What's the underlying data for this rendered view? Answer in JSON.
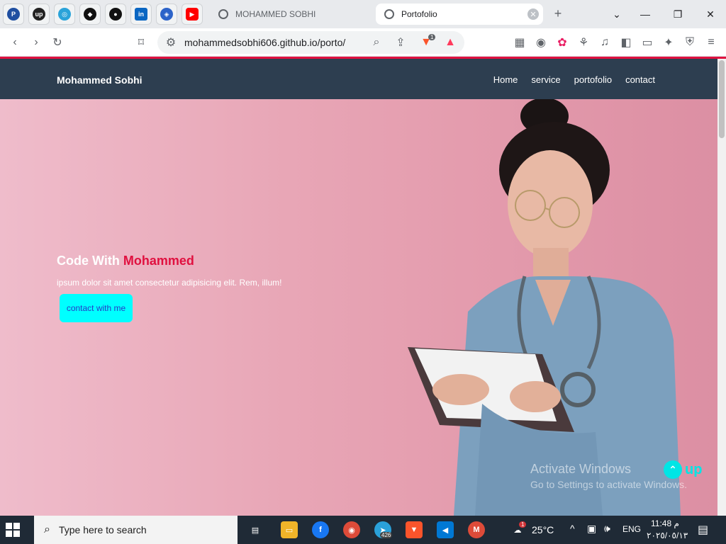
{
  "tabs": {
    "inactive_title": "MOHAMMED SOBHI",
    "active_title": "Portofolio",
    "close": "✕",
    "new_tab": "+"
  },
  "address": {
    "url": "mohammedsobhi606.github.io/porto/",
    "brave_badge": "1"
  },
  "site": {
    "brand": "Mohammed Sobhi",
    "nav": [
      "Home",
      "service",
      "portofolio",
      "contact"
    ],
    "hero_title_prefix": "Code With ",
    "hero_title_accent": "Mohammed",
    "hero_subtitle": "ipsum dolor sit amet consectetur adipisicing elit. Rem, illum!",
    "cta": "contact with me",
    "up_label": "up"
  },
  "watermark": {
    "line1": "Activate Windows",
    "line2": "Go to Settings to activate Windows."
  },
  "taskbar": {
    "search_placeholder": "Type here to search",
    "telegram_badge": "426",
    "weather_badge": "1",
    "temperature": "25°C",
    "language": "ENG",
    "time": "11:48 م",
    "date": "٢٠٢٥/٠٥/١٣"
  },
  "colors": {
    "navbar": "#2d3e50",
    "accent": "#e0103f",
    "cta_bg": "#00ffff",
    "hero_bg": "#e8a6b6"
  }
}
